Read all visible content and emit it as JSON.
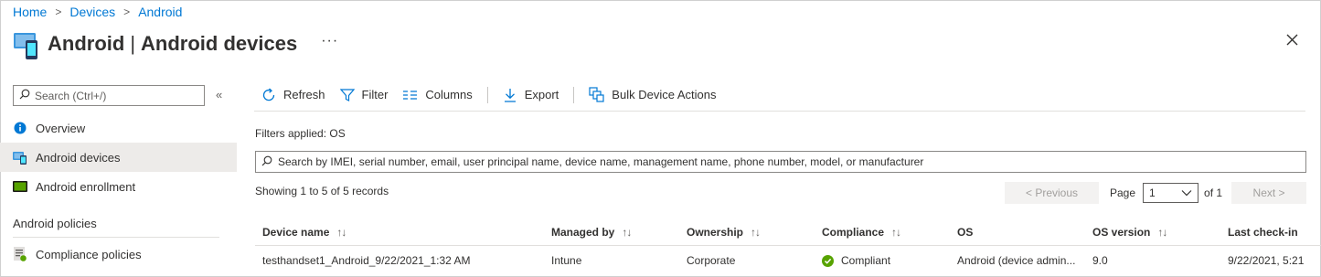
{
  "breadcrumb": [
    "Home",
    "Devices",
    "Android"
  ],
  "header": {
    "title_bold": "Android",
    "title_sep": "|",
    "title_rest": "Android devices",
    "more": "···",
    "close_icon": "close-icon"
  },
  "sidebar": {
    "search_placeholder": "Search (Ctrl+/)",
    "collapse": "«",
    "items": [
      {
        "label": "Overview",
        "icon": "info-icon"
      },
      {
        "label": "Android devices",
        "icon": "devices-icon",
        "active": true
      },
      {
        "label": "Android enrollment",
        "icon": "enrollment-icon"
      }
    ],
    "section": "Android policies",
    "section_items": [
      {
        "label": "Compliance policies",
        "icon": "compliance-policy-icon"
      }
    ]
  },
  "toolbar": {
    "refresh": "Refresh",
    "filter": "Filter",
    "columns": "Columns",
    "export": "Export",
    "bulk": "Bulk Device Actions"
  },
  "filters_applied": "Filters applied: OS",
  "search": {
    "placeholder": "Search by IMEI, serial number, email, user principal name, device name, management name, phone number, model, or manufacturer"
  },
  "showing": "Showing 1 to 5 of 5 records",
  "pager": {
    "previous": "< Previous",
    "page_label": "Page",
    "page_value": "1",
    "of": "of 1",
    "next": "Next >"
  },
  "table": {
    "sort_glyph": "↑↓",
    "columns": [
      "Device name",
      "Managed by",
      "Ownership",
      "Compliance",
      "OS",
      "OS version",
      "Last check-in"
    ],
    "rows": [
      [
        "testhandset1_Android_9/22/2021_1:32 AM",
        "Intune",
        "Corporate",
        "Compliant",
        "Android (device admin...",
        "9.0",
        "9/22/2021, 5:21"
      ]
    ]
  },
  "colors": {
    "accent": "#0078d4",
    "compliant": "#57a300",
    "active_bg": "#edebe9"
  }
}
